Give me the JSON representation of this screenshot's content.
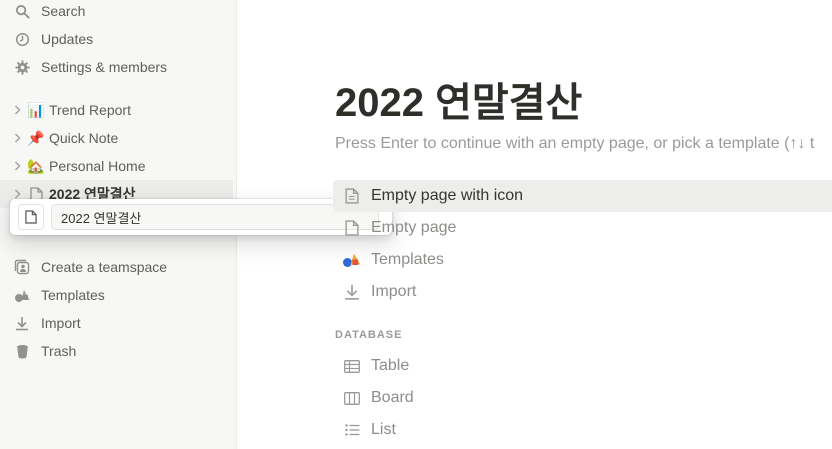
{
  "sidebar": {
    "top_items": [
      {
        "label": "Search",
        "icon": "search-icon"
      },
      {
        "label": "Updates",
        "icon": "clock-icon"
      },
      {
        "label": "Settings & members",
        "icon": "gear-icon"
      }
    ],
    "pages": [
      {
        "label": "Trend Report",
        "emoji": "📊"
      },
      {
        "label": "Quick Note",
        "emoji": "📌"
      },
      {
        "label": "Personal Home",
        "emoji": "🏡"
      },
      {
        "label": "2022 연말결산",
        "emoji": ""
      }
    ],
    "bottom_items": [
      {
        "label": "Create a teamspace",
        "icon": "teamspace-icon"
      },
      {
        "label": "Templates",
        "icon": "templates-icon"
      },
      {
        "label": "Import",
        "icon": "import-icon"
      },
      {
        "label": "Trash",
        "icon": "trash-icon"
      }
    ]
  },
  "rename_popup": {
    "value": "2022 연말결산"
  },
  "main": {
    "title": "2022 연말결산",
    "hint": "Press Enter to continue with an empty page, or pick a template (↑↓ t",
    "options": [
      {
        "label": "Empty page with icon",
        "icon": "page-icon"
      },
      {
        "label": "Empty page",
        "icon": "page-icon"
      },
      {
        "label": "Templates",
        "icon": "templates-icon"
      },
      {
        "label": "Import",
        "icon": "import-icon"
      }
    ],
    "database_label": "DATABASE",
    "database_options": [
      {
        "label": "Table",
        "icon": "table-icon"
      },
      {
        "label": "Board",
        "icon": "board-icon"
      },
      {
        "label": "List",
        "icon": "list-icon"
      }
    ]
  },
  "colors": {
    "sidebar_bg": "#f7f7f5",
    "highlight_bg": "#ededeb",
    "text_primary": "#37352f",
    "text_muted": "#9b9a97"
  }
}
